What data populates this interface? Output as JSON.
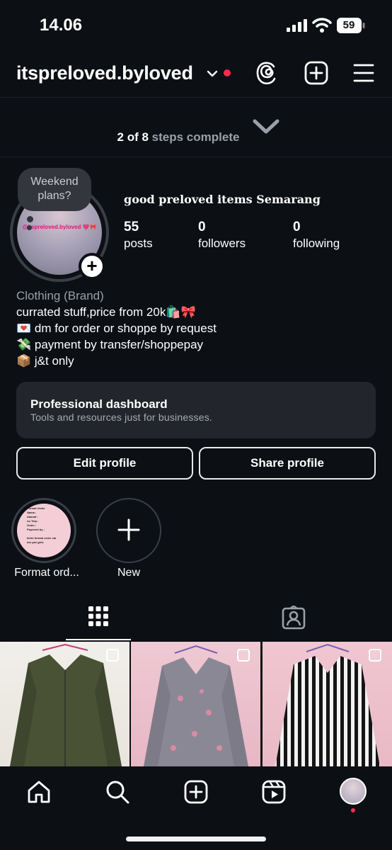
{
  "status_bar": {
    "time": "14.06",
    "battery": "59"
  },
  "header": {
    "username": "itspreloved.byloved"
  },
  "steps": {
    "done": "2 of 8",
    "rest": " steps complete"
  },
  "profile": {
    "note": "Weekend plans?",
    "avatar_caption": "@itspreloved.byloved 💗🎀",
    "name": "good preloved items Semarang",
    "stats": [
      {
        "value": "55",
        "label": "posts"
      },
      {
        "value": "0",
        "label": "followers"
      },
      {
        "value": "0",
        "label": "following"
      }
    ],
    "category": "Clothing (Brand)",
    "bio": [
      "currated stuff,price from 20k🛍️🎀",
      "💌 dm for order or shoppe by request",
      "💸 payment by transfer/shoppepay",
      "📦 j&t only"
    ]
  },
  "dashboard": {
    "title": "Professional dashboard",
    "subtitle": "Tools and resources just for businesses."
  },
  "buttons": {
    "edit": "Edit profile",
    "share": "Share profile"
  },
  "highlights": [
    {
      "label": "Format ord...",
      "note": "Format Order\nNama :\nAlamat :\nno Telp :\nOrder :\nPayment by :\n\nkirim format order via\ndm yah girls"
    },
    {
      "label": "New"
    }
  ],
  "colors": {
    "background": "#0c0f14",
    "card": "#22252b",
    "notification": "#ff2d4a",
    "caption_pink": "#e2157c"
  }
}
